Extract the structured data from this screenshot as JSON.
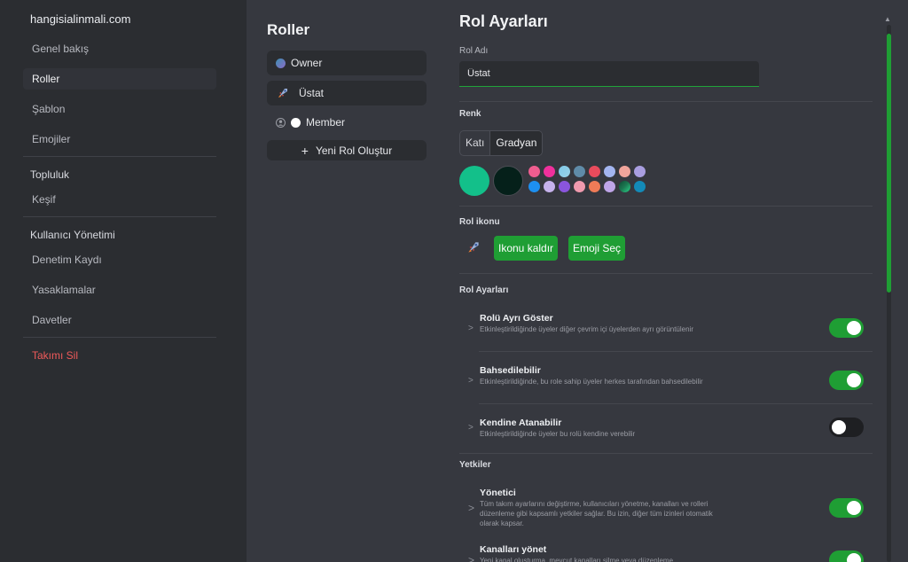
{
  "server": {
    "name": "hangisialinmali.com"
  },
  "nav": {
    "general": "Genel bakış",
    "roles": "Roller",
    "template": "Şablon",
    "emojis": "Emojiler",
    "community_heading": "Topluluk",
    "discovery": "Keşif",
    "user_mgmt_heading": "Kullanıcı Yönetimi",
    "audit_log": "Denetim Kaydı",
    "bans": "Yasaklamalar",
    "invites": "Davetler",
    "delete_team": "Takımı Sil"
  },
  "roles": {
    "title": "Roller",
    "items": [
      {
        "name": "Owner",
        "icon": "gradient-dot-icon"
      },
      {
        "name": "Üstat",
        "icon": "rocket-emoji-icon"
      },
      {
        "name": "Member",
        "icon": "person-icon"
      }
    ],
    "new_role": "Yeni Rol Oluştur"
  },
  "role_settings": {
    "title": "Rol Ayarları",
    "name_label": "Rol Adı",
    "name_value": "Üstat",
    "color_label": "Renk",
    "color_modes": [
      "Katı",
      "Gradyan"
    ],
    "selected_mode": "Gradyan",
    "primary_colors": [
      "#13c08a",
      "#05201a"
    ],
    "palette": [
      "#ef5d8f",
      "#f0309c",
      "#9ad2e6",
      "#5f8ba8",
      "#e84b5c",
      "#a3b5f0",
      "#f0a49b",
      "#a99ee0",
      "#1d8ff0",
      "#c6b2ec",
      "#8a55dd",
      "#f09aae",
      "#ef7b57",
      "#bfa5e8",
      "#1c7a52",
      "#138ab8"
    ],
    "palette_first": "#7ec8e8",
    "icon_label": "Rol ikonu",
    "remove_icon": "Ikonu kaldır",
    "pick_emoji": "Emoji Seç",
    "settings_label": "Rol Ayarları",
    "settings": [
      {
        "title": "Rolü Ayrı Göster",
        "desc": "Etkinleştirildiğinde üyeler diğer çevrim içi üyelerden ayrı görüntülenir",
        "enabled": true
      },
      {
        "title": "Bahsedilebilir",
        "desc": "Etkinleştirildiğinde, bu role sahip üyeler herkes tarafından bahsedilebilir",
        "enabled": true
      },
      {
        "title": "Kendine Atanabilir",
        "desc": "Etkinleştirildiğinde üyeler bu rolü kendine verebilir",
        "enabled": false
      }
    ],
    "permissions_label": "Yetkiler",
    "permissions": [
      {
        "title": "Yönetici",
        "desc": "Tüm takım ayarlarını değiştirme, kullanıcıları yönetme, kanalları ve rolleri düzenleme gibi kapsamlı yetkiler sağlar. Bu izin, diğer tüm izinleri otomatik olarak kapsar.",
        "enabled": true
      },
      {
        "title": "Kanalları yönet",
        "desc": "Yeni kanal oluşturma, mevcut kanalları silme veya düzenleme",
        "enabled": true
      }
    ]
  }
}
